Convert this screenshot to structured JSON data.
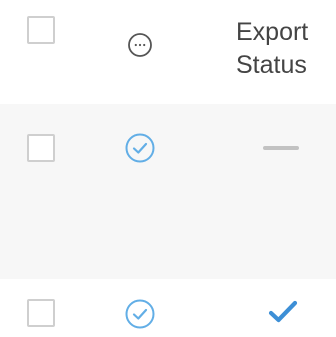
{
  "header": {
    "export_status_line1": "Export",
    "export_status_line2": "Status"
  },
  "rows": [
    {
      "selected": false,
      "status": "check-circle",
      "export_status": "none"
    },
    {
      "selected": false,
      "status": "check-circle",
      "export_status": "exported"
    }
  ],
  "colors": {
    "accent": "#3d8fd6",
    "check_circle": "#62aee6",
    "row_alt_bg": "#f7f7f7",
    "checkbox_border": "#cfcfcf",
    "header_text": "#444444",
    "dash": "#c2c2c2"
  }
}
